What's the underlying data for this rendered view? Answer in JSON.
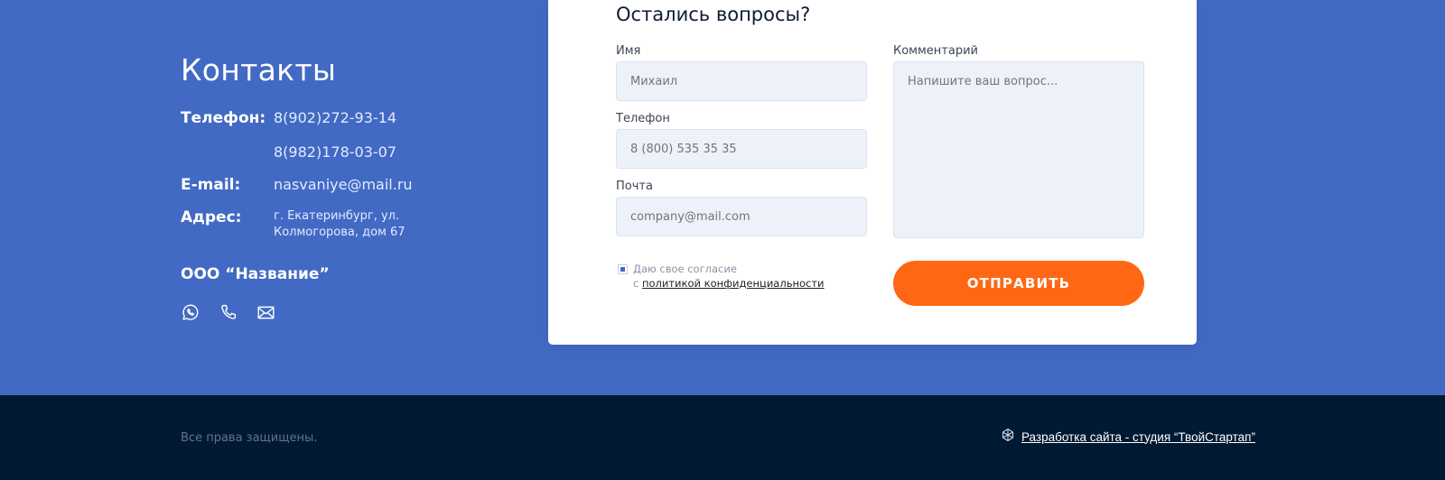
{
  "contacts": {
    "title": "Контакты",
    "phone_label": "Телефон:",
    "phones": [
      "8(902)272-93-14",
      "8(982)178-03-07"
    ],
    "email_label": "E-mail:",
    "email": "nasvaniye@mail.ru",
    "address_label": "Адрес:",
    "address_lines": [
      "г. Екатеринбург, ул.",
      "Колмогорова, дом 67"
    ],
    "company": "ООО “Название”",
    "socials": [
      "whatsapp-icon",
      "phone-icon",
      "mail-icon"
    ]
  },
  "form": {
    "title": "Остались вопросы?",
    "name_label": "Имя",
    "name_placeholder": "Михаил",
    "phone_label": "Телефон",
    "phone_placeholder": "8 (800) 535 35 35",
    "email_label": "Почта",
    "email_placeholder": "company@mail.com",
    "comment_label": "Комментарий",
    "comment_placeholder": "Напишите ваш вопрос...",
    "consent_line1": "Даю свое согласие",
    "consent_prefix": "с",
    "consent_link": "политикой конфиденциальности",
    "consent_checked": true,
    "submit_label": "ОТПРАВИТЬ"
  },
  "footer": {
    "rights": "Все права защищены.",
    "developer_link": "Разработка сайта - студия “ТвойСтартап”",
    "developer_icon": "studio-logo-icon"
  },
  "colors": {
    "band": "#426ac4",
    "footer": "#001a33",
    "accent": "#ff6714",
    "input_bg": "#edf1f9"
  }
}
